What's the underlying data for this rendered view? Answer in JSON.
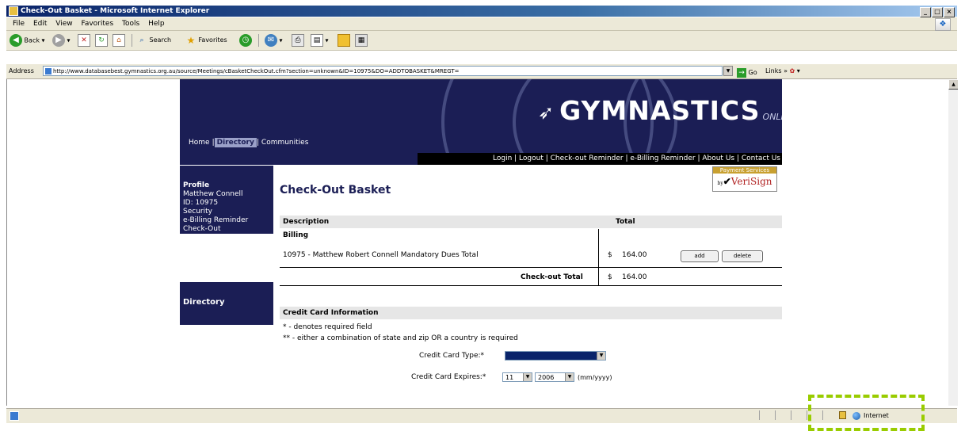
{
  "window": {
    "title": "Check-Out Basket - Microsoft Internet Explorer"
  },
  "menu": [
    "File",
    "Edit",
    "View",
    "Favorites",
    "Tools",
    "Help"
  ],
  "toolbar": {
    "back": "Back",
    "search": "Search",
    "favorites": "Favorites"
  },
  "address": {
    "label": "Address",
    "url": "http://www.databasebest.gymnastics.org.au/source/Meetings/cBasketCheckOut.cfm?section=unknown&ID=10975&DO=ADDTOBASKET&MREGT=",
    "go": "Go",
    "links": "Links"
  },
  "site": {
    "logo": "GYMNASTICS",
    "logo_sub": "ONLINE",
    "nav": [
      "Home",
      "Directory",
      "Communities"
    ],
    "subnav": "Login | Logout | Check-out Reminder | e-Billing Reminder | About Us | Contact Us"
  },
  "sidebar": {
    "profile_title": "Profile",
    "profile_items": [
      "Matthew Connell",
      "ID: 10975",
      "Security",
      "e-Billing Reminder",
      "Check-Out"
    ],
    "directory_title": "Directory"
  },
  "checkout": {
    "title": "Check-Out Basket",
    "verisign_top": "Payment Services",
    "verisign_by": "by",
    "verisign_name": "VeriSign",
    "col_description": "Description",
    "col_total": "Total",
    "section": "Billing",
    "item_description": "10975 - Matthew Robert Connell Mandatory Dues Total",
    "item_currency": "$",
    "item_amount": "164.00",
    "add_label": "add",
    "delete_label": "delete",
    "total_label": "Check-out Total",
    "total_currency": "$",
    "total_amount": "164.00"
  },
  "credit_card": {
    "heading": "Credit Card Information",
    "note1": "* - denotes required field",
    "note2": "** - either a combination of state and zip OR a country is required",
    "type_label": "Credit Card Type:*",
    "expires_label": "Credit Card Expires:*",
    "exp_month": "11",
    "exp_year": "2006",
    "exp_hint": "(mm/yyyy)"
  },
  "status": {
    "zone": "Internet"
  },
  "colors": {
    "site_navy": "#1b1e55",
    "highlight": "#99cc00"
  }
}
